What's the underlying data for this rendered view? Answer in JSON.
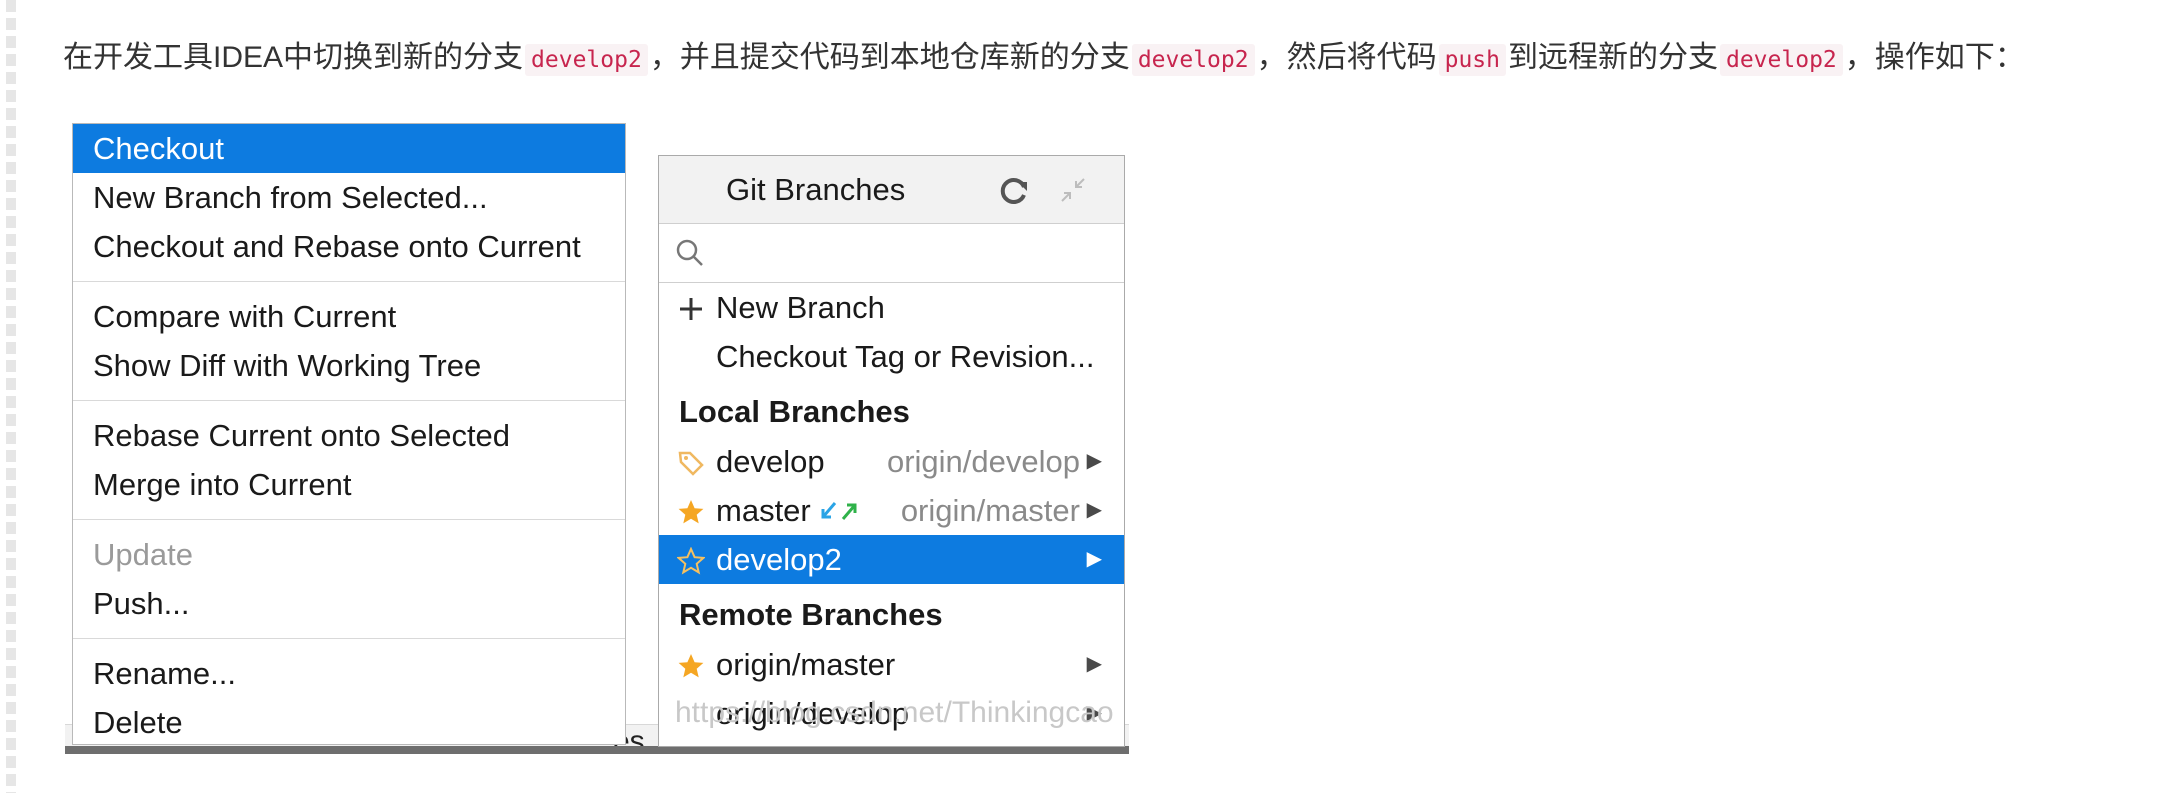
{
  "intro": {
    "t1": "在开发工具IDEA中切换到新的分支",
    "c1": "develop2",
    "t2": "，并且提交代码到本地仓库新的分支",
    "c2": "develop2",
    "t3": "，然后将代码",
    "c3": "push",
    "t4": "到远程新的分支",
    "c4": "develop2",
    "t5": "，操作如下："
  },
  "context_menu": {
    "items": [
      {
        "label": "Checkout",
        "state": "selected"
      },
      {
        "label": "New Branch from Selected..."
      },
      {
        "label": "Checkout and Rebase onto Current"
      },
      {
        "label": "Compare with Current"
      },
      {
        "label": "Show Diff with Working Tree"
      },
      {
        "label": "Rebase Current onto Selected"
      },
      {
        "label": "Merge into Current"
      },
      {
        "label": "Update",
        "state": "disabled"
      },
      {
        "label": "Push..."
      },
      {
        "label": "Rename..."
      },
      {
        "label": "Delete"
      }
    ]
  },
  "git_branches": {
    "title": "Git Branches",
    "search_placeholder": "",
    "actions": [
      {
        "label": "New Branch",
        "icon": "plus-icon"
      },
      {
        "label": "Checkout Tag or Revision..."
      }
    ],
    "local_header": "Local Branches",
    "local": [
      {
        "name": "develop",
        "tracking": "origin/develop",
        "icon": "tag-icon"
      },
      {
        "name": "master",
        "tracking": "origin/master",
        "icon": "star-icon"
      },
      {
        "name": "develop2",
        "tracking": "",
        "icon": "star-outline-icon",
        "selected": true
      }
    ],
    "remote_header": "Remote Branches",
    "remote": [
      {
        "name": "origin/master",
        "icon": "star-icon"
      },
      {
        "name": "origin/develop"
      }
    ]
  },
  "background_peek": "es",
  "watermark": "https://blog.csdn.net/Thinkingcao",
  "colors": {
    "selection": "#0d7be0",
    "star": "#f5a623",
    "code_text": "#c7254e",
    "code_bg": "#f9f2f4"
  }
}
